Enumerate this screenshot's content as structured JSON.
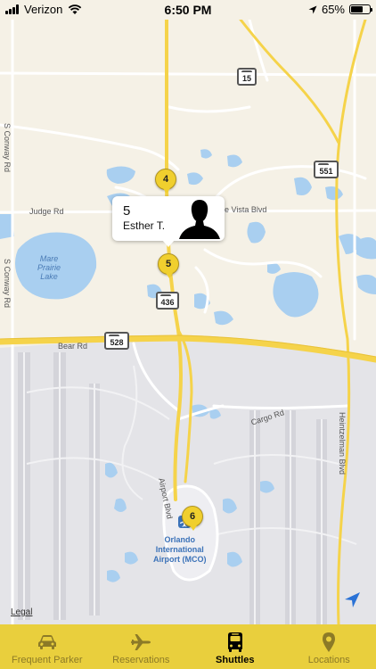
{
  "status_bar": {
    "carrier": "Verizon",
    "time": "6:50 PM",
    "battery": "65%",
    "battery_level": 0.65
  },
  "map": {
    "road_labels": {
      "judge_rd": "Judge Rd",
      "vista_blvd": "e Vista Blvd",
      "bear_rd": "Bear Rd",
      "cargo_rd": "Cargo Rd",
      "airport_blvd": "Airport Blvd",
      "heintzelman_blvd": "Heintzelman Blvd",
      "conway_rd_upper": "S Conway Rd",
      "conway_rd_lower": "S Conway Rd"
    },
    "shields": {
      "r15": "15",
      "r551": "551",
      "r436": "436",
      "r528": "528"
    },
    "water_label": "Mare\nPrairie\nLake",
    "airport_label": "Orlando\nInternational\nAirport (MCO)",
    "markers": {
      "m4": "4",
      "m5": "5",
      "m6": "6"
    },
    "callout": {
      "number": "5",
      "name": "Esther T."
    },
    "legal": "Legal"
  },
  "tabs": [
    {
      "label": "Frequent Parker",
      "icon": "car-icon",
      "active": false
    },
    {
      "label": "Reservations",
      "icon": "airplane-icon",
      "active": false
    },
    {
      "label": "Shuttles",
      "icon": "bus-icon",
      "active": true
    },
    {
      "label": "Locations",
      "icon": "location-pin-icon",
      "active": false
    }
  ],
  "colors": {
    "tab_bar": "#e9cf3d",
    "marker": "#f0cf2e",
    "land": "#f5f1e6",
    "airport_area": "#e4e4e8",
    "water": "#a9cff0",
    "highway": "#f5d34a"
  }
}
